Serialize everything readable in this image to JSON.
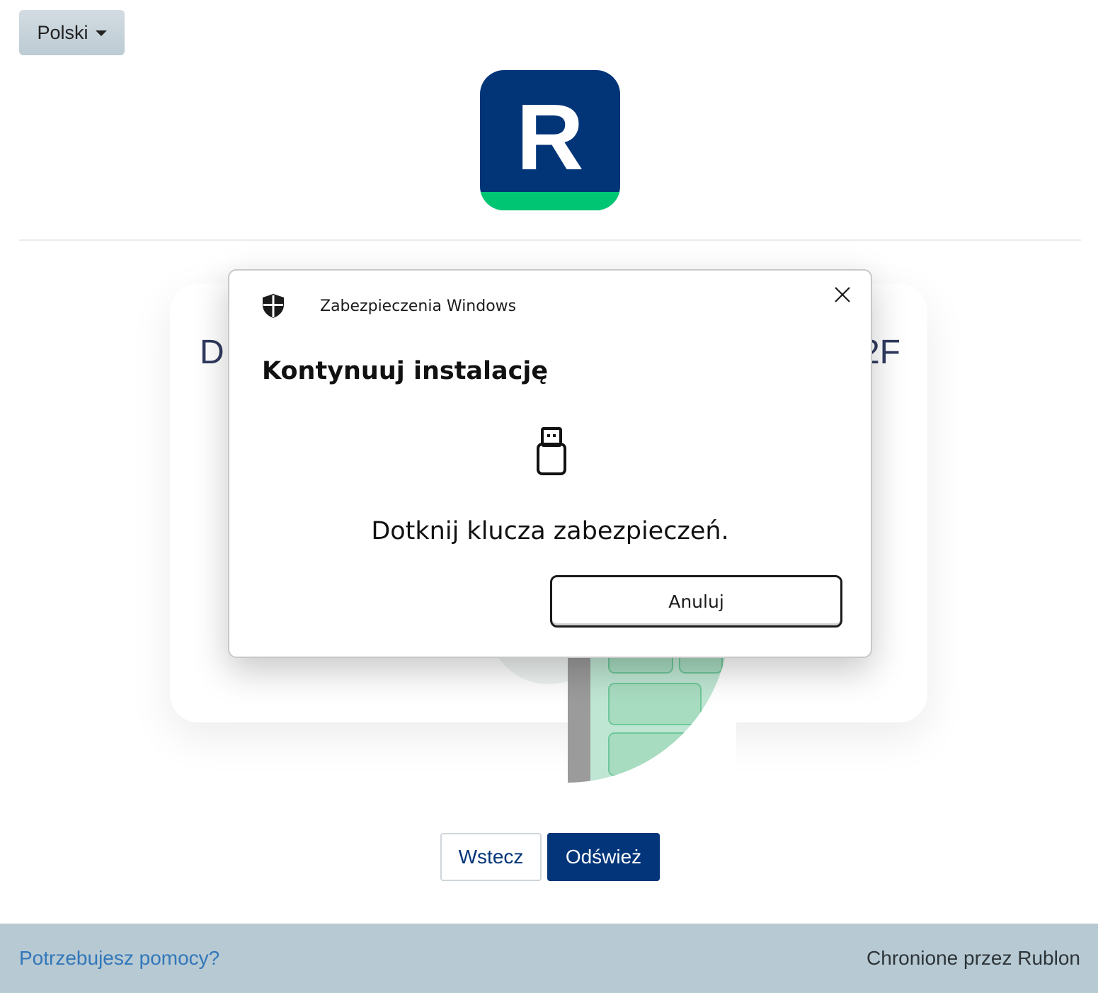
{
  "language": {
    "selected": "Polski"
  },
  "logo": {
    "letter": "R",
    "color": "#023578",
    "accent": "#00c674"
  },
  "page": {
    "title_left_fragment": "D",
    "title_right_fragment": "2F",
    "back_label": "Wstecz",
    "refresh_label": "Odśwież"
  },
  "footer": {
    "help_link": "Potrzebujesz pomocy?",
    "protected_by": "Chronione przez Rublon"
  },
  "dialog": {
    "app_name": "Zabezpieczenia Windows",
    "title": "Kontynuuj instalację",
    "message": "Dotknij klucza zabezpieczeń.",
    "cancel_label": "Anuluj"
  }
}
